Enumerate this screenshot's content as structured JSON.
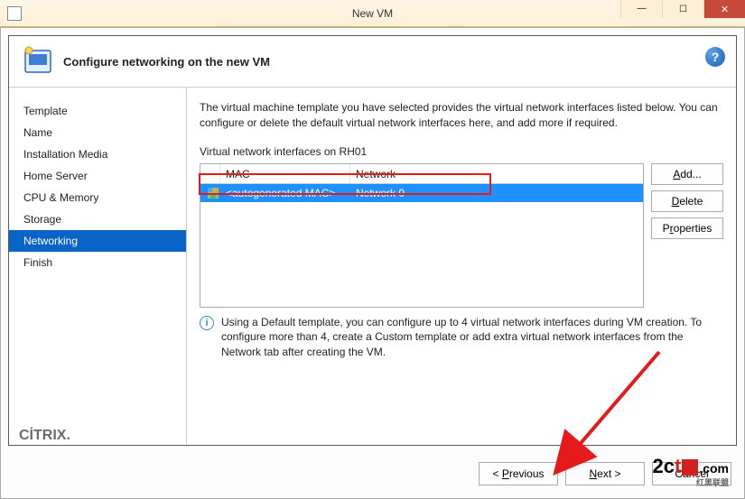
{
  "window": {
    "title": "New VM"
  },
  "header": {
    "title": "Configure networking on the new VM"
  },
  "sidebar": {
    "steps": [
      "Template",
      "Name",
      "Installation Media",
      "Home Server",
      "CPU & Memory",
      "Storage",
      "Networking",
      "Finish"
    ],
    "active_index": 6
  },
  "main": {
    "description": "The virtual machine template you have selected provides the virtual network interfaces listed below. You can configure or delete the default virtual network interfaces here, and add more if required.",
    "table_label": "Virtual network interfaces on RH01",
    "columns": {
      "mac": "MAC",
      "network": "Network"
    },
    "rows": [
      {
        "mac": "<autogenerated MAC>",
        "network": "Network 0"
      }
    ],
    "buttons": {
      "add": "Add...",
      "delete": "Delete",
      "properties": "Properties"
    },
    "info": "Using a Default template, you can configure up to 4 virtual network interfaces during VM creation. To configure more than 4, create a Custom template or add extra virtual network interfaces from the Network tab after creating the VM."
  },
  "footer": {
    "brand": "CİTRIX",
    "previous": "< Previous",
    "next": "Next >",
    "cancel": "Cancel"
  },
  "watermark": {
    "text": "2cto.com",
    "tag": "红黑联盟"
  }
}
